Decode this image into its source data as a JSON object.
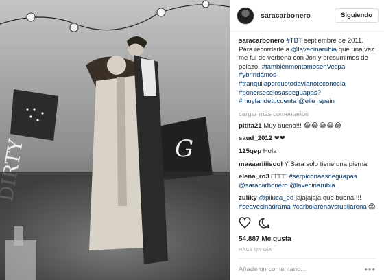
{
  "photo": {
    "description_icon": "photo-icon",
    "sign_text": "DIRTY"
  },
  "header": {
    "username": "saracarbonero",
    "follow_label": "Siguiendo"
  },
  "caption": {
    "username": "saracarbonero",
    "tag1": "#TBT",
    "text1": " septiembre de 2011. Para recordarle a ",
    "mention1": "@lavecinarubia",
    "text2": " que una vez me fui de verbena con Jon y presumimos de pelazo.",
    "hashtags": "#tambiénmontamosenVespa #ybrindamos #tranquilaporquetodavíanoteconocía #ponersecelosasdeguapas? #muyfandetucuenta",
    "mention2": "@elle_spain"
  },
  "load_more": "cargar más comentarios",
  "comments": [
    {
      "user": "pitita21",
      "text": "Muy bueno!!! 😂😂😂😂😂"
    },
    {
      "user": "saud_2012",
      "text": "❤❤"
    },
    {
      "user": "125qep",
      "text": "Hola"
    },
    {
      "user": "maaaariiiisool",
      "text": "Y Sara solo tiene una pierna"
    },
    {
      "user": "elena_ro3",
      "text": "□□□□ ",
      "link": "#serpiconaesdeguapas @saracarbonero @lavecinarubia"
    },
    {
      "user": "zuliky",
      "text": " jajajajaja que buena !!! ",
      "mention": "@piluca_ed",
      "link": "#seavecinadrama #carbojarenavsrubijarena",
      "emoji": "😱😂"
    }
  ],
  "likes": "54.887 Me gusta",
  "time": "HACE UN DÍA",
  "comment_input": {
    "placeholder": "Añade un comentario..."
  },
  "icons": {
    "like": "heart-icon",
    "comment": "comment-bubble-icon",
    "options": "more-options-icon"
  }
}
